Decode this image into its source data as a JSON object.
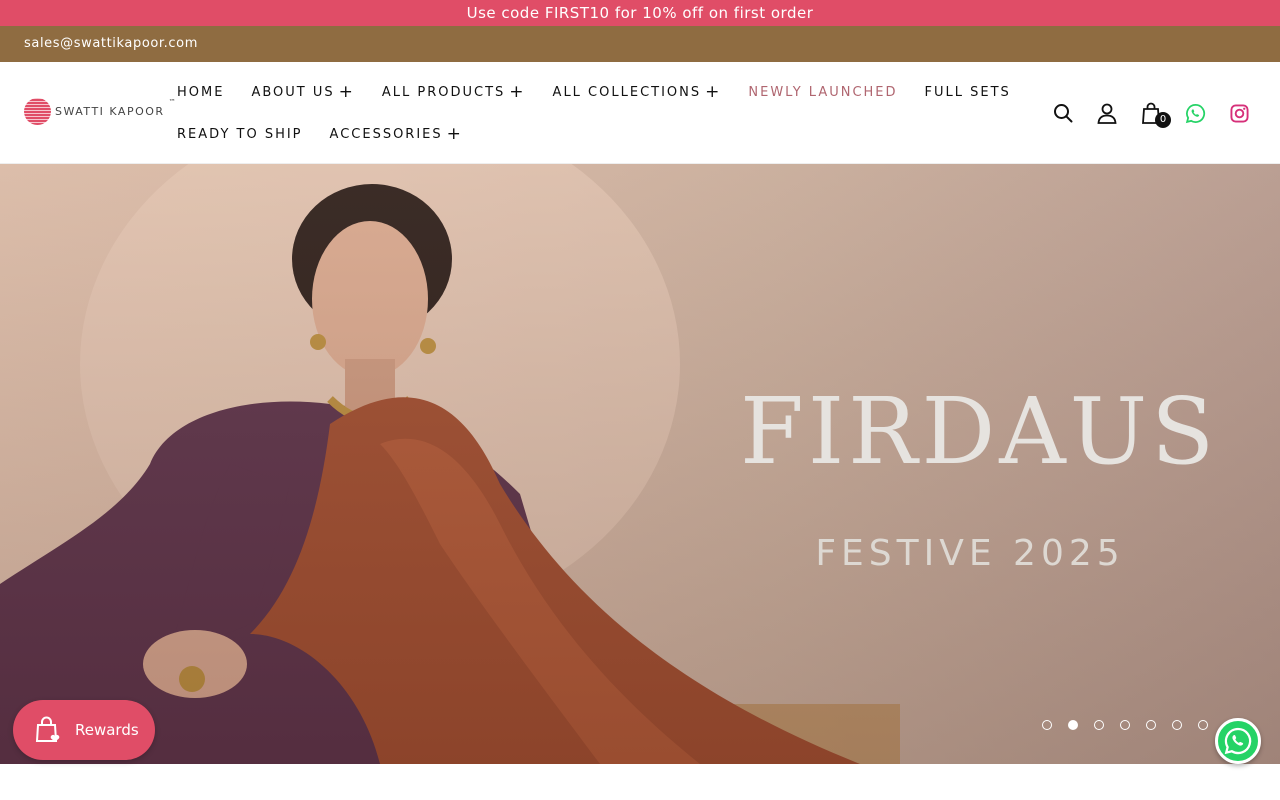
{
  "promo": {
    "text": "Use code FIRST10 for 10% off on first order"
  },
  "contact": {
    "email": "sales@swattikapoor.com"
  },
  "brand": {
    "name": "SWATTI KAPOOR",
    "tm": "™"
  },
  "nav": {
    "row1": [
      {
        "label": "HOME",
        "has_submenu": false,
        "accent": false
      },
      {
        "label": "ABOUT US",
        "has_submenu": true,
        "accent": false
      },
      {
        "label": "ALL PRODUCTS",
        "has_submenu": true,
        "accent": false
      },
      {
        "label": "ALL COLLECTIONS",
        "has_submenu": true,
        "accent": false
      },
      {
        "label": "NEWLY LAUNCHED",
        "has_submenu": false,
        "accent": true
      },
      {
        "label": "FULL SETS",
        "has_submenu": false,
        "accent": false
      }
    ],
    "row2": [
      {
        "label": "READY TO SHIP",
        "has_submenu": false,
        "accent": false
      },
      {
        "label": "ACCESSORIES",
        "has_submenu": true,
        "accent": false
      }
    ],
    "submenu_symbol": "+"
  },
  "header_icons": {
    "search": "search-icon",
    "account": "user-icon",
    "cart": "bag-icon",
    "cart_count": "0",
    "whatsapp": "whatsapp-icon",
    "instagram": "instagram-icon"
  },
  "hero": {
    "title": "FIRDAUS",
    "subtitle": "FESTIVE 2025",
    "slides_total": 7,
    "active_slide": 2
  },
  "rewards": {
    "label": "Rewards"
  },
  "colors": {
    "promo_bg": "#e04d67",
    "contact_bg": "#8f6c41",
    "accent_nav": "#b06670",
    "whatsapp": "#25d366",
    "instagram": "#d6307a"
  }
}
